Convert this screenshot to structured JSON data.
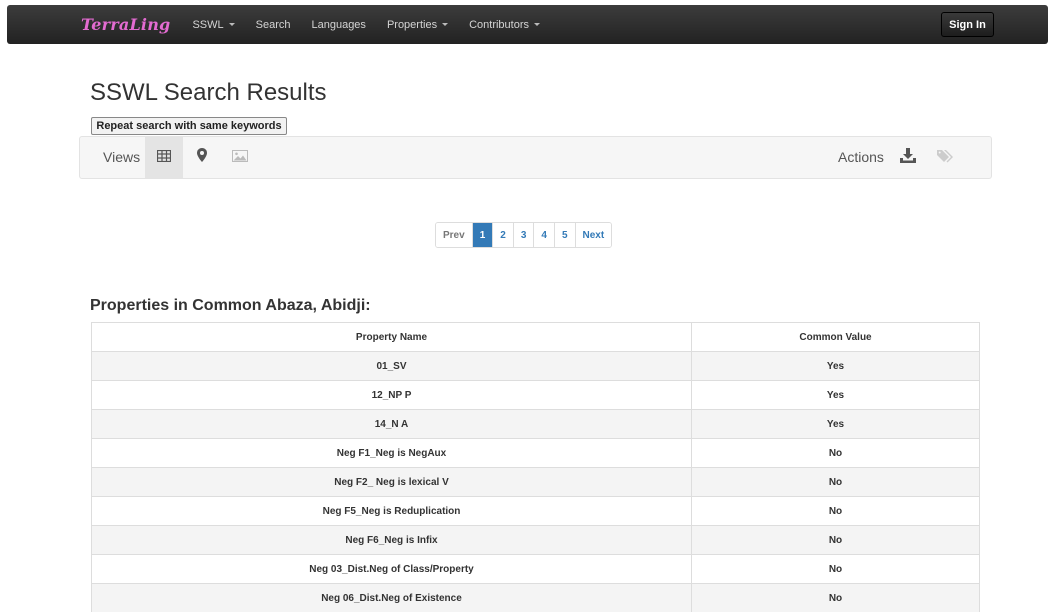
{
  "navbar": {
    "brand": "TerraLing",
    "items": [
      {
        "label": "SSWL",
        "dropdown": true
      },
      {
        "label": "Search",
        "dropdown": false
      },
      {
        "label": "Languages",
        "dropdown": false
      },
      {
        "label": "Properties",
        "dropdown": true
      },
      {
        "label": "Contributors",
        "dropdown": true
      }
    ],
    "sign_in": "Sign In"
  },
  "page_title": "SSWL Search Results",
  "repeat_button": "Repeat search with same keywords",
  "toolbar": {
    "views_label": "Views",
    "views": [
      "table-icon",
      "map-marker-icon",
      "picture-icon"
    ],
    "active_view": "table-icon",
    "actions_label": "Actions",
    "actions": [
      "download-icon",
      "tags-icon"
    ]
  },
  "pagination": {
    "prev": "Prev",
    "pages": [
      "1",
      "2",
      "3",
      "4",
      "5"
    ],
    "current": "1",
    "next": "Next"
  },
  "section_title": "Properties in Common Abaza, Abidji:",
  "table": {
    "headers": [
      "Property Name",
      "Common Value"
    ],
    "rows": [
      [
        "01_SV",
        "Yes"
      ],
      [
        "12_NP P",
        "Yes"
      ],
      [
        "14_N A",
        "Yes"
      ],
      [
        "Neg F1_Neg is NegAux",
        "No"
      ],
      [
        "Neg F2_ Neg is lexical V",
        "No"
      ],
      [
        "Neg F5_Neg is Reduplication",
        "No"
      ],
      [
        "Neg F6_Neg is Infix",
        "No"
      ],
      [
        "Neg 03_Dist.Neg of Class/Property",
        "No"
      ],
      [
        "Neg 06_Dist.Neg of Existence",
        "No"
      ]
    ]
  },
  "colors": {
    "accent": "#337ab7",
    "brand": "#e36bd1",
    "navbar": "#2b2b2b"
  }
}
